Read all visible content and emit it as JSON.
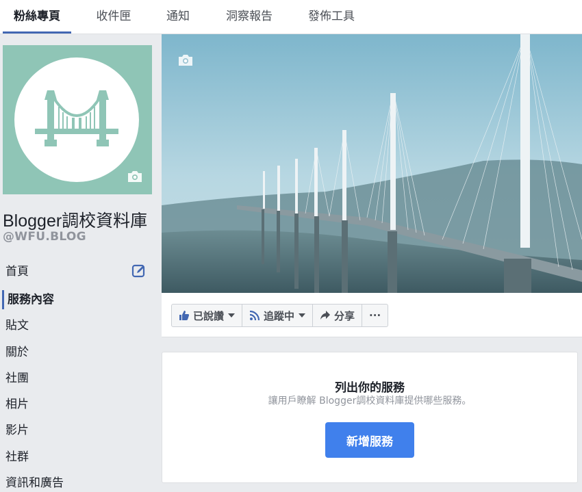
{
  "tabs": [
    {
      "label": "粉絲專頁",
      "active": true
    },
    {
      "label": "收件匣",
      "active": false
    },
    {
      "label": "通知",
      "active": false
    },
    {
      "label": "洞察報告",
      "active": false
    },
    {
      "label": "發佈工具",
      "active": false
    }
  ],
  "page": {
    "name": "Blogger調校資料庫",
    "handle": "@WFU.BLOG",
    "avatar_bg": "#8fc5b6"
  },
  "sidebar": {
    "items": [
      {
        "label": "首頁"
      },
      {
        "label": "服務內容",
        "active": true
      },
      {
        "label": "貼文"
      },
      {
        "label": "關於"
      },
      {
        "label": "社團"
      },
      {
        "label": "相片"
      },
      {
        "label": "影片"
      },
      {
        "label": "社群"
      },
      {
        "label": "資訊和廣告"
      }
    ]
  },
  "actions": {
    "liked": "已說讚",
    "following": "追蹤中",
    "share": "分享",
    "more": "···"
  },
  "services": {
    "title": "列出你的服務",
    "subtitle": "讓用戶瞭解 Blogger調校資料庫提供哪些服務。",
    "button": "新增服務"
  },
  "colors": {
    "accent": "#4267b2",
    "button": "#4080ec"
  }
}
